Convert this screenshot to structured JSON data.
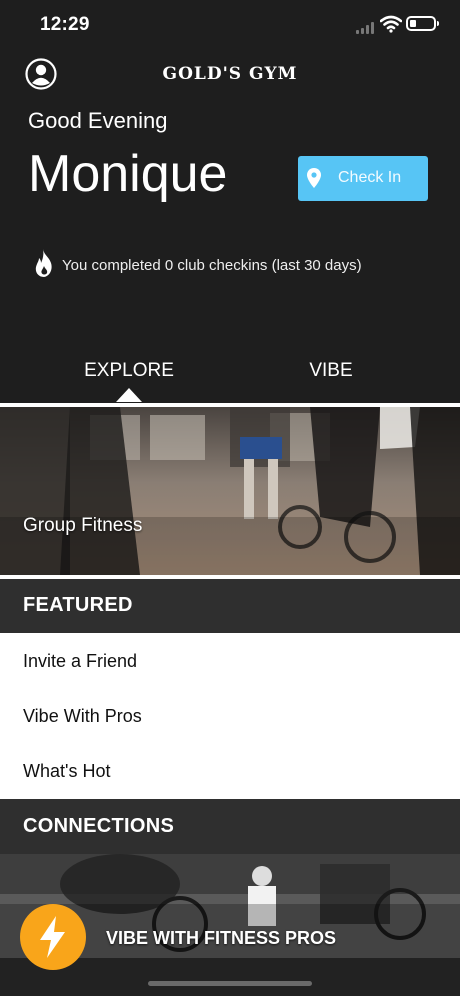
{
  "status_bar": {
    "time": "12:29",
    "battery_level": 0.2
  },
  "header": {
    "logo": "GOLD'S GYM",
    "greeting": "Good Evening",
    "user_name": "Monique",
    "checkin_label": "Check In",
    "checkins_summary": "You completed 0 club checkins (last 30 days)"
  },
  "tabs": [
    {
      "label": "EXPLORE",
      "selected": true
    },
    {
      "label": "VIBE",
      "selected": false
    }
  ],
  "explore": {
    "group_fitness_title": "Group Fitness"
  },
  "featured": {
    "title": "FEATURED",
    "items": [
      "Invite a Friend",
      "Vibe With Pros",
      "What's Hot"
    ]
  },
  "connections": {
    "title": "CONNECTIONS",
    "card_title": "VIBE WITH FITNESS PROS"
  },
  "colors": {
    "accent_blue": "#57c5f5",
    "bolt_orange": "#f9a51a",
    "section_header": "#2f2f2f"
  }
}
